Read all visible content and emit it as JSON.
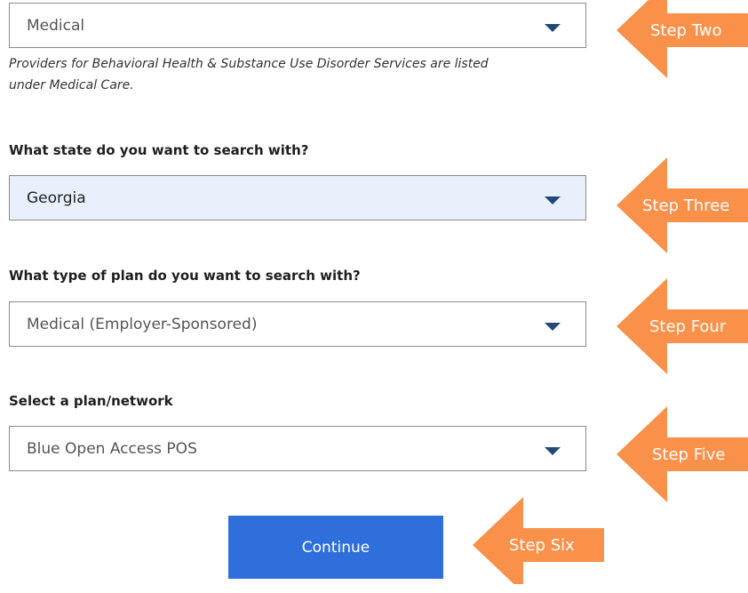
{
  "step_two": {
    "dropdown_value": "Medical",
    "note": "Providers for Behavioral Health & Substance Use Disorder Services are listed under Medical Care.",
    "arrow_label": "Step Two"
  },
  "step_three": {
    "question": "What state do you want to search with?",
    "dropdown_value": "Georgia",
    "arrow_label": "Step Three"
  },
  "step_four": {
    "question": "What type of plan do you want to search with?",
    "dropdown_value": "Medical (Employer-Sponsored)",
    "arrow_label": "Step Four"
  },
  "step_five": {
    "question": "Select a plan/network",
    "dropdown_value": "Blue Open Access POS",
    "arrow_label": "Step Five"
  },
  "step_six": {
    "button_label": "Continue",
    "arrow_label": "Step Six"
  },
  "colors": {
    "arrow": "#f9914a",
    "button": "#2f6fdb",
    "highlight": "#e8f0fc",
    "caret": "#234a76"
  },
  "icons": [
    "chevron-down-icon",
    "left-arrow-callout"
  ]
}
